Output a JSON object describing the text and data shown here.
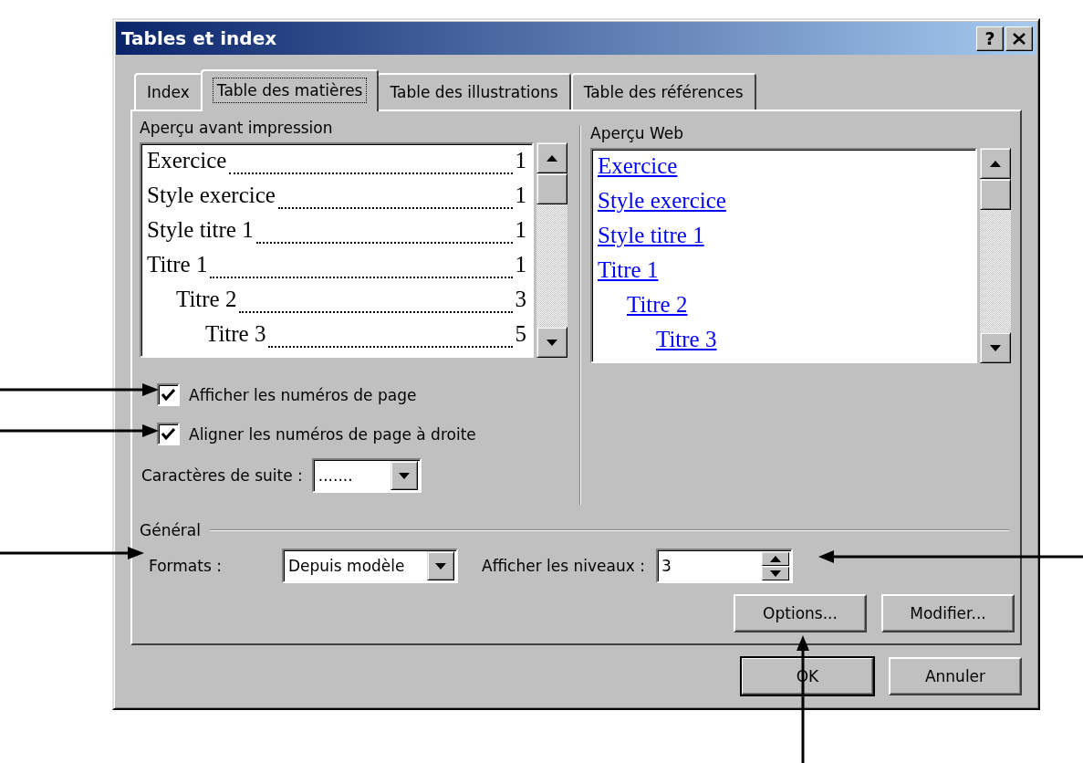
{
  "window": {
    "title": "Tables et index",
    "help_button": "?"
  },
  "tabs": [
    {
      "label": "Index",
      "selected": false
    },
    {
      "label": "Table des matières",
      "selected": true
    },
    {
      "label": "Table des illustrations",
      "selected": false
    },
    {
      "label": "Table des références",
      "selected": false
    }
  ],
  "print_preview": {
    "label": "Aperçu avant impression",
    "entries": [
      {
        "text": "Exercice",
        "page": "1"
      },
      {
        "text": "Style exercice",
        "page": "1"
      },
      {
        "text": "Style titre 1",
        "page": "1"
      },
      {
        "text": "Titre 1",
        "page": "1",
        "children": [
          {
            "text": "Titre 2",
            "page": "3",
            "children": [
              {
                "text": "Titre 3",
                "page": "5"
              }
            ]
          }
        ]
      }
    ]
  },
  "web_preview": {
    "label": "Aperçu Web",
    "entries": [
      {
        "text": "Exercice"
      },
      {
        "text": "Style exercice"
      },
      {
        "text": "Style titre 1"
      },
      {
        "text": "Titre 1",
        "children": [
          {
            "text": "Titre 2",
            "children": [
              {
                "text": "Titre 3"
              }
            ]
          }
        ]
      }
    ]
  },
  "checkboxes": [
    {
      "label": "Afficher les numéros de page",
      "checked": true
    },
    {
      "label": "Aligner les numéros de page à droite",
      "checked": true
    }
  ],
  "tab_leader": {
    "label": "Caractères de suite :",
    "value": "......."
  },
  "general": {
    "label": "Général",
    "formats": {
      "label": "Formats :",
      "value": "Depuis modèle"
    },
    "levels": {
      "label": "Afficher les niveaux :",
      "value": "3"
    }
  },
  "panel_buttons": [
    {
      "label": "Options..."
    },
    {
      "label": "Modifier..."
    }
  ],
  "buttons": [
    {
      "label": "OK",
      "default": true
    },
    {
      "label": "Annuler",
      "default": false
    }
  ]
}
